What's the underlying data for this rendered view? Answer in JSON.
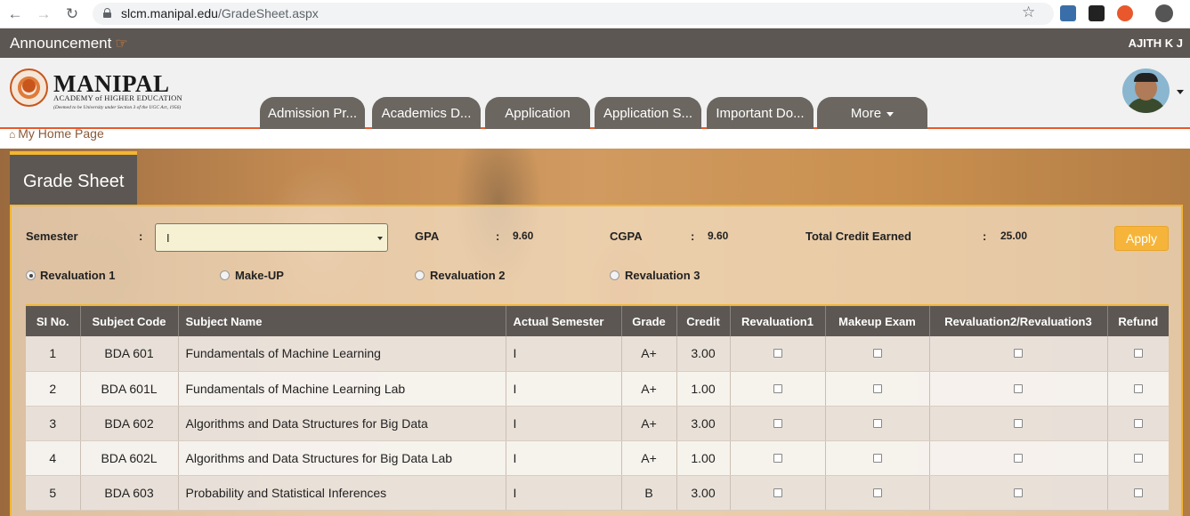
{
  "browser": {
    "url_host": "slcm.manipal.edu",
    "url_path": "/GradeSheet.aspx"
  },
  "topbar": {
    "announcement": "Announcement",
    "user_name": "AJITH K J"
  },
  "logo": {
    "name": "MANIPAL",
    "subtitle": "ACADEMY of HIGHER EDUCATION",
    "tagline": "(Deemed to be University under Section 3 of the UGC Act, 1956)",
    "seal_text": "INSPIRED BY LIFE"
  },
  "nav": {
    "tabs": [
      {
        "label": "Admission Pr..."
      },
      {
        "label": "Academics D..."
      },
      {
        "label": "Application"
      },
      {
        "label": "Application S..."
      },
      {
        "label": "Important Do..."
      },
      {
        "label": "More"
      }
    ]
  },
  "breadcrumb": "My Home Page",
  "page_title": "Grade Sheet",
  "filters": {
    "semester_label": "Semester",
    "semester_value": "I",
    "gpa_label": "GPA",
    "gpa_value": "9.60",
    "cgpa_label": "CGPA",
    "cgpa_value": "9.60",
    "credit_label": "Total Credit Earned",
    "credit_value": "25.00",
    "apply_label": "Apply",
    "colon": ":"
  },
  "options": [
    {
      "label": "Revaluation 1",
      "selected": true
    },
    {
      "label": "Make-UP",
      "selected": false
    },
    {
      "label": "Revaluation 2",
      "selected": false
    },
    {
      "label": "Revaluation 3",
      "selected": false
    }
  ],
  "table": {
    "headers": [
      "SI No.",
      "Subject Code",
      "Subject Name",
      "Actual Semester",
      "Grade",
      "Credit",
      "Revaluation1",
      "Makeup Exam",
      "Revaluation2/Revaluation3",
      "Refund"
    ],
    "rows": [
      {
        "sl": "1",
        "code": "BDA 601",
        "name": "Fundamentals of Machine Learning",
        "sem": "I",
        "grade": "A+",
        "credit": "3.00"
      },
      {
        "sl": "2",
        "code": "BDA 601L",
        "name": "Fundamentals of Machine Learning Lab",
        "sem": "I",
        "grade": "A+",
        "credit": "1.00"
      },
      {
        "sl": "3",
        "code": "BDA 602",
        "name": "Algorithms and Data Structures for Big Data",
        "sem": "I",
        "grade": "A+",
        "credit": "3.00"
      },
      {
        "sl": "4",
        "code": "BDA 602L",
        "name": "Algorithms and Data Structures for Big Data Lab",
        "sem": "I",
        "grade": "A+",
        "credit": "1.00"
      },
      {
        "sl": "5",
        "code": "BDA 603",
        "name": "Probability and Statistical Inferences",
        "sem": "I",
        "grade": "B",
        "credit": "3.00"
      }
    ]
  },
  "colors": {
    "accent": "#f3b631",
    "header_bg": "#5c5752",
    "brand_orange": "#e8582c"
  }
}
